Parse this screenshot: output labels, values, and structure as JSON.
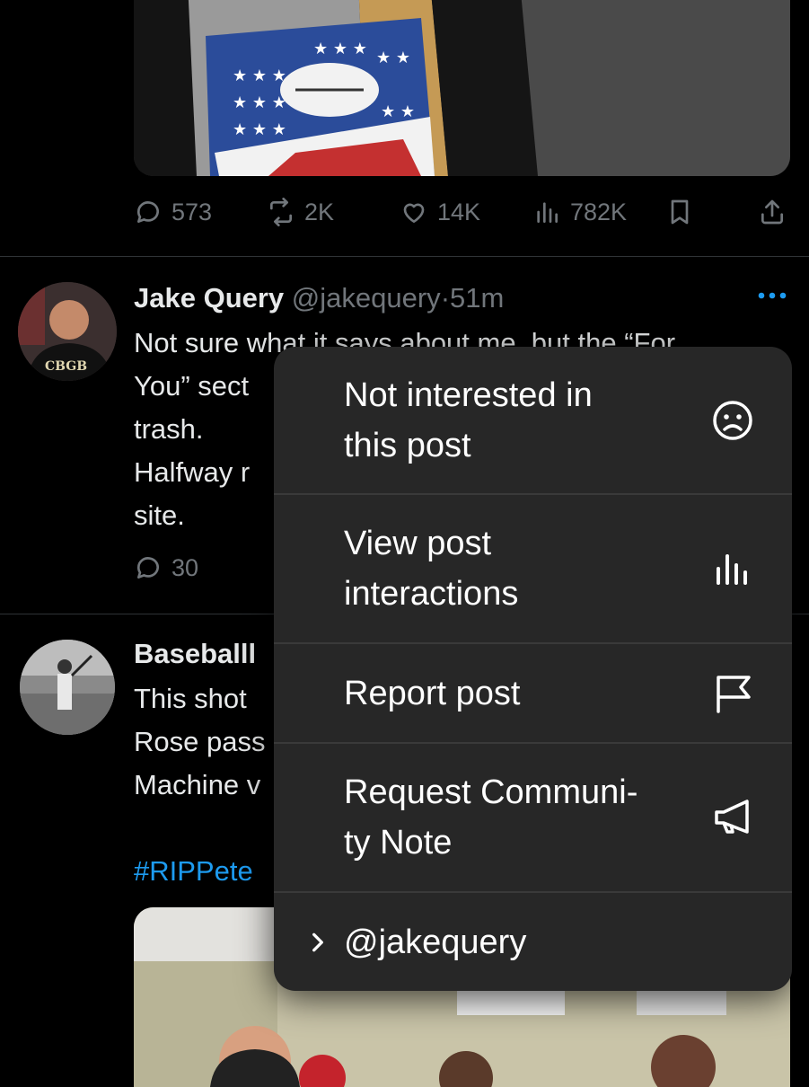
{
  "tweet1": {
    "stats": {
      "replies": "573",
      "reposts": "2K",
      "likes": "14K",
      "views": "782K"
    }
  },
  "tweet2": {
    "name": "Jake Query",
    "handle": "@jakequery",
    "separator": "·",
    "time": "51m",
    "lines": [
      "Not sure what it says about me, but the “For",
      "You” sect",
      "trash.",
      "Halfway r",
      "site."
    ],
    "replies": "30",
    "more_icon": "more-dots-icon",
    "avatar_text": "CBGB"
  },
  "tweet3": {
    "name": "Baseballl",
    "lines": [
      "This shot",
      "Rose pass",
      "Machine v"
    ],
    "hashtag": "#RIPPete"
  },
  "menu": {
    "items": [
      {
        "label": "Not interested in\nthis post",
        "icon": "sad-face-icon"
      },
      {
        "label": "View post\ninteractions",
        "icon": "bar-chart-icon"
      },
      {
        "label": "Report post",
        "icon": "flag-icon"
      },
      {
        "label": "Request Communi-\nty Note",
        "icon": "megaphone-icon"
      }
    ],
    "account": "@jakequery",
    "account_icon": "chevron-right-icon"
  },
  "colors": {
    "background": "#000000",
    "text": "#e7e9ea",
    "muted": "#71767b",
    "accent": "#1d9bf0",
    "menu_bg": "#272727"
  }
}
